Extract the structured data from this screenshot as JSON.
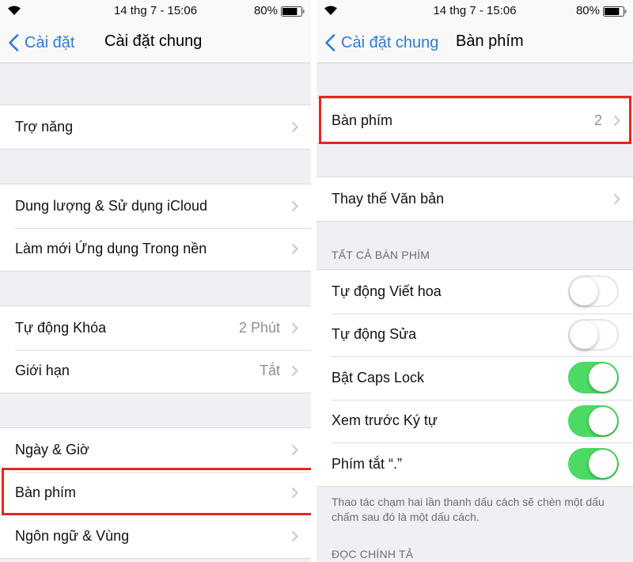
{
  "status_bar": {
    "time": "14 thg 7 - 15:06",
    "battery_percent": "80%",
    "battery_level": 0.8,
    "icons": [
      "wifi-icon",
      "battery-icon"
    ]
  },
  "left_screen": {
    "nav": {
      "back_label": "Cài đặt",
      "title": "Cài đặt chung"
    },
    "groups": [
      {
        "rows": [
          {
            "label": "Trợ năng",
            "value": ""
          }
        ]
      },
      {
        "rows": [
          {
            "label": "Dung lượng & Sử dụng iCloud",
            "value": ""
          },
          {
            "label": "Làm mới Ứng dụng Trong nền",
            "value": ""
          }
        ]
      },
      {
        "rows": [
          {
            "label": "Tự động Khóa",
            "value": "2 Phút"
          },
          {
            "label": "Giới hạn",
            "value": "Tắt"
          }
        ]
      },
      {
        "rows": [
          {
            "label": "Ngày & Giờ",
            "value": ""
          },
          {
            "label": "Bàn phím",
            "value": "",
            "highlighted": true
          },
          {
            "label": "Ngôn ngữ & Vùng",
            "value": ""
          }
        ]
      }
    ]
  },
  "right_screen": {
    "nav": {
      "back_label": "Cài đặt chung",
      "title": "Bàn phím"
    },
    "keyboards_row": {
      "label": "Bàn phím",
      "value": "2",
      "highlighted": true
    },
    "text_replacement_row": {
      "label": "Thay thế Văn bản"
    },
    "all_keyboards_header": "TẤT CẢ BÀN PHÍM",
    "toggles": [
      {
        "label": "Tự động Viết hoa",
        "on": false
      },
      {
        "label": "Tự động Sửa",
        "on": false
      },
      {
        "label": "Bật Caps Lock",
        "on": true
      },
      {
        "label": "Xem trước Ký tự",
        "on": true
      },
      {
        "label": "Phím tắt “.”",
        "on": true
      }
    ],
    "footer_text": "Thao tác chạm hai lần thanh dấu cách sẽ chèn một dấu chấm sau đó là một dấu cách.",
    "dictation_header": "ĐỌC CHÍNH TẢ"
  },
  "colors": {
    "accent_blue": "#2f7ad4",
    "toggle_on_green": "#4cd964",
    "highlight_red": "#e8251c",
    "grouped_background": "#efeff4"
  }
}
